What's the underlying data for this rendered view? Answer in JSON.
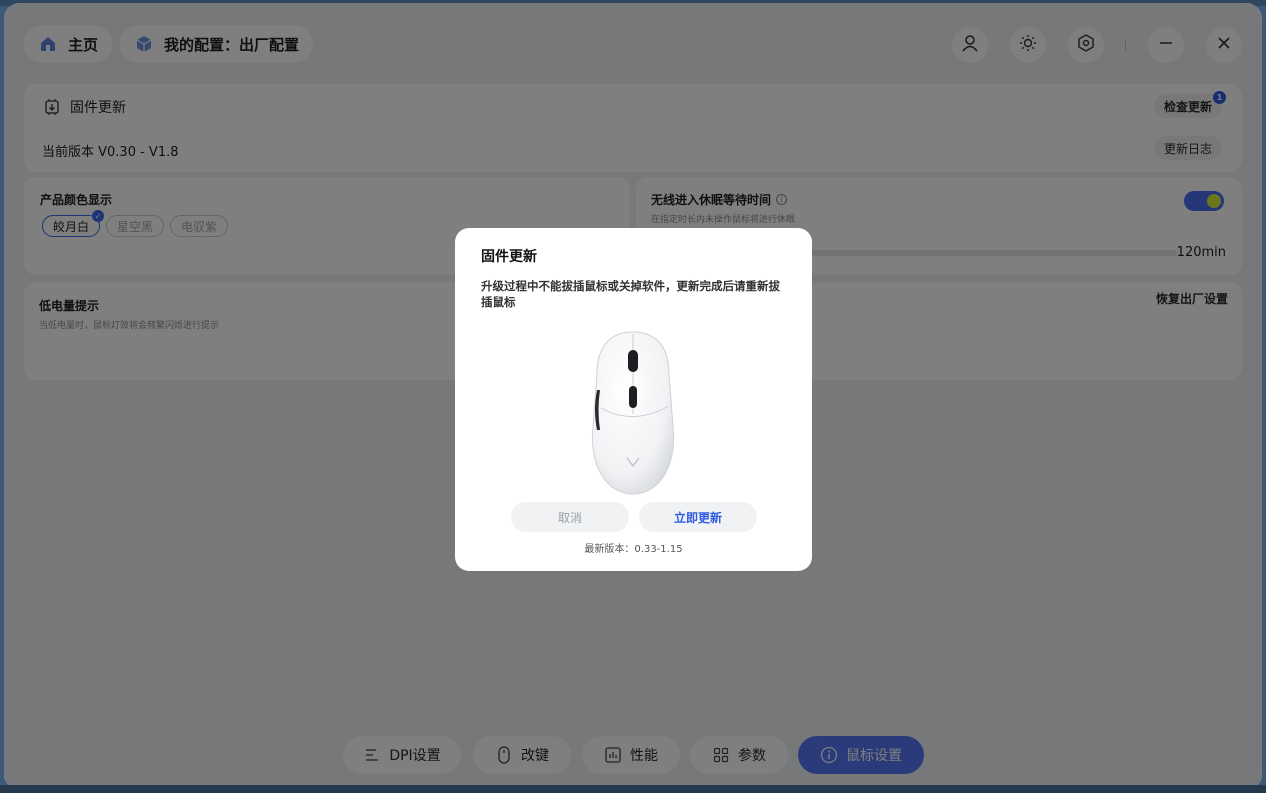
{
  "header": {
    "home_label": "主页",
    "config_label": "我的配置：出厂配置",
    "icons": [
      "user-icon",
      "brightness-icon",
      "settings-icon",
      "minimize-icon",
      "close-icon"
    ]
  },
  "firmware": {
    "title": "固件更新",
    "current_version": "当前版本 V0.30 - V1.8",
    "check_update_label": "检查更新",
    "update_badge": "1",
    "changelog_label": "更新日志"
  },
  "product_color": {
    "title": "产品颜色显示",
    "options": [
      "皎月白",
      "星空黑",
      "电驭紫"
    ],
    "selected": "皎月白"
  },
  "sleep": {
    "title": "无线进入休眠等待时间",
    "hint": "在指定时长内未操作鼠标将进行休眠",
    "value": "120min",
    "enabled": true
  },
  "low_battery": {
    "title": "低电量提示",
    "hint": "当低电量时，鼠标灯效将会频繁闪烁进行提示"
  },
  "restore_label": "恢复出厂设置",
  "bottom_nav": {
    "items": [
      {
        "label": "DPI设置",
        "icon": "dpi-icon"
      },
      {
        "label": "改键",
        "icon": "mouse-icon"
      },
      {
        "label": "性能",
        "icon": "performance-icon"
      },
      {
        "label": "参数",
        "icon": "grid-icon"
      },
      {
        "label": "鼠标设置",
        "icon": "info-icon",
        "active": true
      }
    ]
  },
  "dialog": {
    "title": "固件更新",
    "message": "升级过程中不能拔插鼠标或关掉软件，更新完成后请重新拔插鼠标",
    "cancel_label": "取消",
    "update_label": "立即更新",
    "latest_version": "最新版本：0.33-1.15"
  },
  "colors": {
    "accent": "#3a6ae8",
    "toggle_on": "#4b6ef0",
    "toggle_knob": "#d5f03a"
  }
}
